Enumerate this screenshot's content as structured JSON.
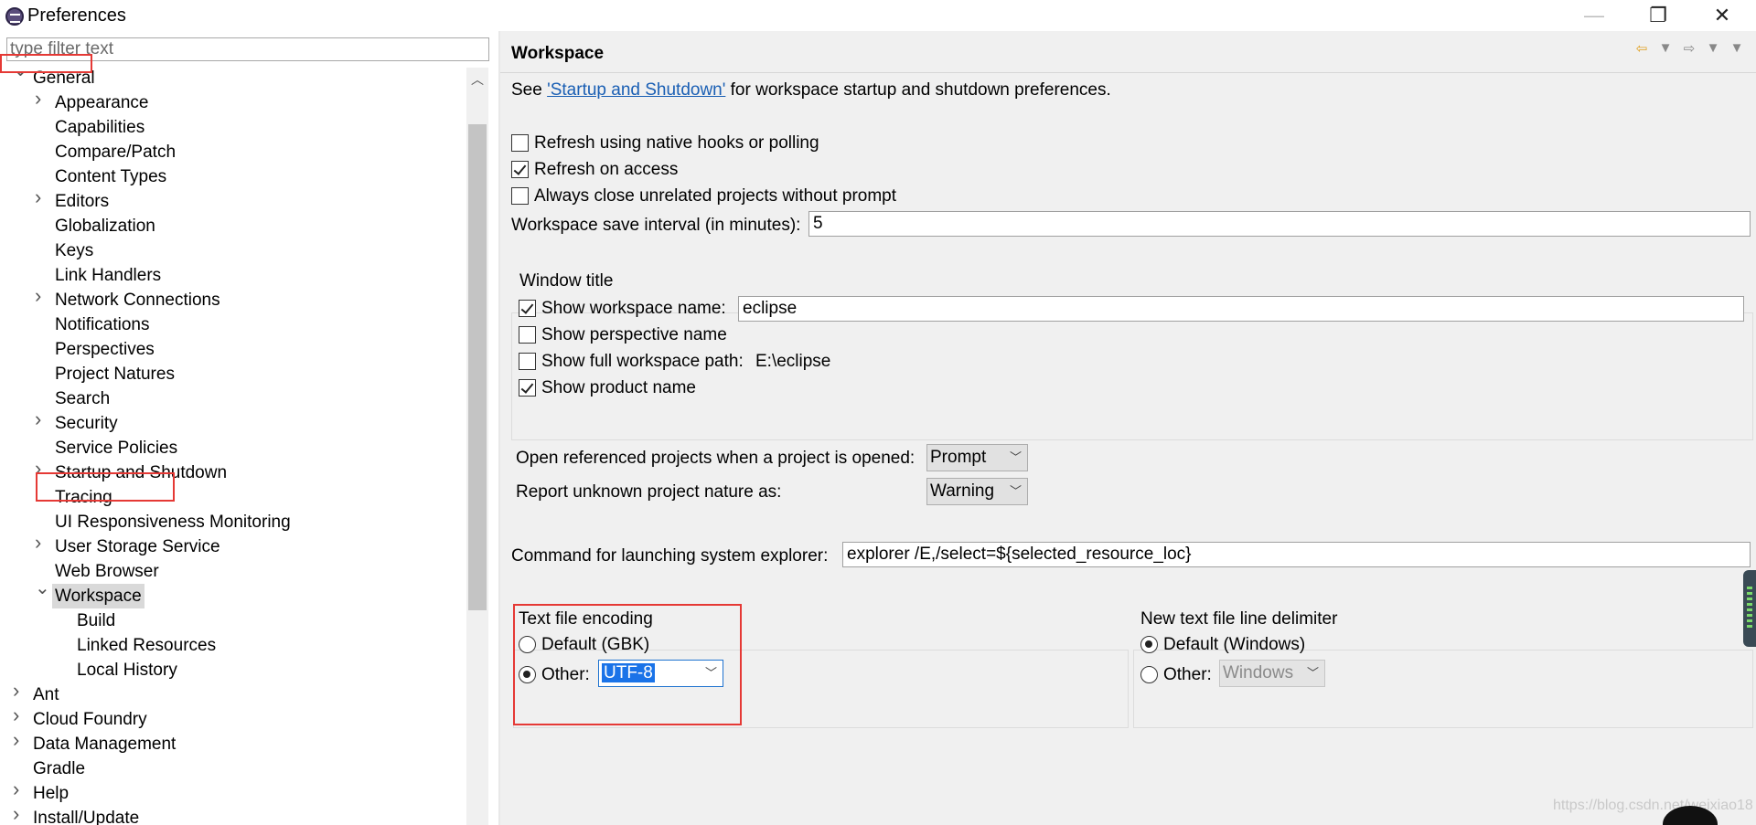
{
  "window": {
    "title": "Preferences"
  },
  "filter": {
    "placeholder": "type filter text"
  },
  "tree": [
    {
      "label": "General",
      "level": 0,
      "state": "expanded"
    },
    {
      "label": "Appearance",
      "level": 1,
      "state": "collapsed"
    },
    {
      "label": "Capabilities",
      "level": 1,
      "state": "leaf"
    },
    {
      "label": "Compare/Patch",
      "level": 1,
      "state": "leaf"
    },
    {
      "label": "Content Types",
      "level": 1,
      "state": "leaf"
    },
    {
      "label": "Editors",
      "level": 1,
      "state": "collapsed"
    },
    {
      "label": "Globalization",
      "level": 1,
      "state": "leaf"
    },
    {
      "label": "Keys",
      "level": 1,
      "state": "leaf"
    },
    {
      "label": "Link Handlers",
      "level": 1,
      "state": "leaf"
    },
    {
      "label": "Network Connections",
      "level": 1,
      "state": "collapsed"
    },
    {
      "label": "Notifications",
      "level": 1,
      "state": "leaf"
    },
    {
      "label": "Perspectives",
      "level": 1,
      "state": "leaf"
    },
    {
      "label": "Project Natures",
      "level": 1,
      "state": "leaf"
    },
    {
      "label": "Search",
      "level": 1,
      "state": "leaf"
    },
    {
      "label": "Security",
      "level": 1,
      "state": "collapsed"
    },
    {
      "label": "Service Policies",
      "level": 1,
      "state": "leaf"
    },
    {
      "label": "Startup and Shutdown",
      "level": 1,
      "state": "collapsed"
    },
    {
      "label": "Tracing",
      "level": 1,
      "state": "leaf"
    },
    {
      "label": "UI Responsiveness Monitoring",
      "level": 1,
      "state": "leaf"
    },
    {
      "label": "User Storage Service",
      "level": 1,
      "state": "collapsed"
    },
    {
      "label": "Web Browser",
      "level": 1,
      "state": "leaf"
    },
    {
      "label": "Workspace",
      "level": 1,
      "state": "expanded",
      "selected": true
    },
    {
      "label": "Build",
      "level": 2,
      "state": "leaf"
    },
    {
      "label": "Linked Resources",
      "level": 2,
      "state": "leaf"
    },
    {
      "label": "Local History",
      "level": 2,
      "state": "leaf"
    },
    {
      "label": "Ant",
      "level": 0,
      "state": "collapsed"
    },
    {
      "label": "Cloud Foundry",
      "level": 0,
      "state": "collapsed"
    },
    {
      "label": "Data Management",
      "level": 0,
      "state": "collapsed"
    },
    {
      "label": "Gradle",
      "level": 0,
      "state": "leaf"
    },
    {
      "label": "Help",
      "level": 0,
      "state": "collapsed"
    },
    {
      "label": "Install/Update",
      "level": 0,
      "state": "collapsed"
    }
  ],
  "page": {
    "title": "Workspace",
    "intro_prefix": "See ",
    "intro_link": "'Startup and Shutdown'",
    "intro_suffix": " for workspace startup and shutdown preferences.",
    "refresh_native": {
      "label": "Refresh using native hooks or polling",
      "checked": false
    },
    "refresh_access": {
      "label": "Refresh on access",
      "checked": true
    },
    "always_close": {
      "label": "Always close unrelated projects without prompt",
      "checked": false
    },
    "save_interval": {
      "label": "Workspace save interval (in minutes):",
      "value": "5"
    },
    "window_title": {
      "group_label": "Window title",
      "show_ws_name": {
        "label": "Show workspace name:",
        "checked": true,
        "value": "eclipse"
      },
      "show_perspective": {
        "label": "Show perspective name",
        "checked": false
      },
      "show_full_path": {
        "label": "Show full workspace path:",
        "checked": false,
        "value": "E:\\eclipse"
      },
      "show_product": {
        "label": "Show product name",
        "checked": true
      }
    },
    "open_ref": {
      "label": "Open referenced projects when a project is opened:",
      "value": "Prompt"
    },
    "unknown_nature": {
      "label": "Report unknown project nature as:",
      "value": "Warning"
    },
    "explorer_cmd": {
      "label": "Command for launching system explorer:",
      "value": "explorer /E,/select=${selected_resource_loc}"
    },
    "encoding": {
      "group_label": "Text file encoding",
      "default_label": "Default (GBK)",
      "other_label": "Other:",
      "other_value": "UTF-8",
      "selected": "other"
    },
    "delimiter": {
      "group_label": "New text file line delimiter",
      "default_label": "Default (Windows)",
      "other_label": "Other:",
      "other_value": "Windows",
      "selected": "default"
    }
  },
  "watermark": "https://blog.csdn.net/weixiao18"
}
